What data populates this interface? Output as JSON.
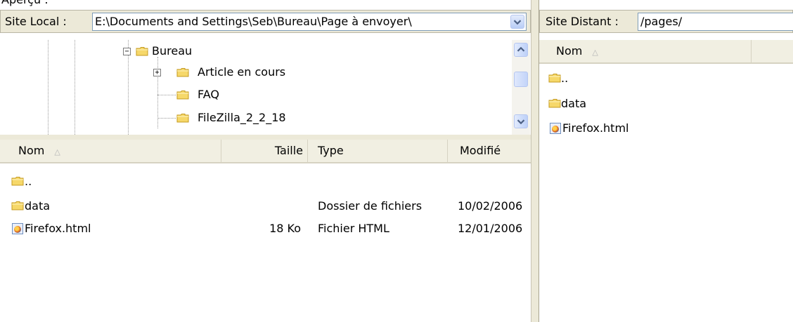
{
  "top_caption": "Aperçu :",
  "local": {
    "address_label": "Site Local :",
    "address_value": "E:\\Documents and Settings\\Seb\\Bureau\\Page à envoyer\\",
    "tree": [
      {
        "label": "Bureau",
        "expander": "−"
      },
      {
        "label": "Article en cours",
        "expander": "+"
      },
      {
        "label": "FAQ",
        "expander": ""
      },
      {
        "label": "FileZilla_2_2_18",
        "expander": ""
      }
    ],
    "columns": {
      "name": "Nom",
      "size": "Taille",
      "type": "Type",
      "modified": "Modifié"
    },
    "files": [
      {
        "name": "..",
        "size": "",
        "type": "",
        "modified": ""
      },
      {
        "name": "data",
        "size": "",
        "type": "Dossier de fichiers",
        "modified": "10/02/2006"
      },
      {
        "name": "Firefox.html",
        "size": "18 Ko",
        "type": "Fichier HTML",
        "modified": "12/01/2006"
      }
    ]
  },
  "remote": {
    "address_label": "Site Distant :",
    "address_value": "/pages/",
    "columns": {
      "name": "Nom"
    },
    "files": [
      {
        "name": ".."
      },
      {
        "name": "data"
      },
      {
        "name": "Firefox.html"
      }
    ]
  },
  "icons": {
    "folder": "folder-icon",
    "firefox_file": "firefox-html-icon",
    "sort": "sort-ascending-icon"
  },
  "colors": {
    "chrome": "#ece9d8",
    "header": "#f1efe2",
    "scroll_accent": "#4d6185",
    "folder": "#f3cf5f"
  }
}
